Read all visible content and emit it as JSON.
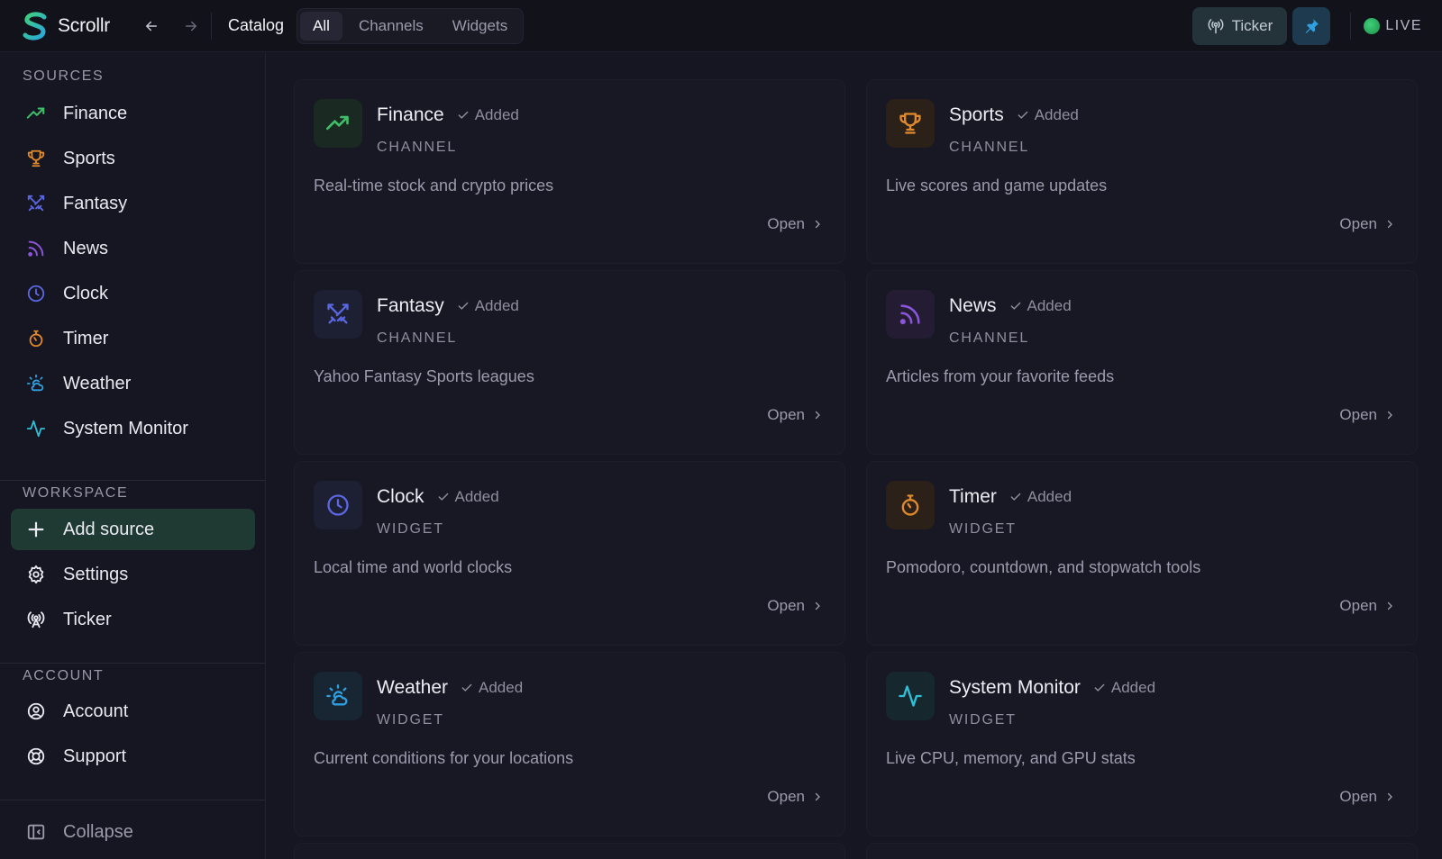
{
  "app": {
    "name": "Scrollr"
  },
  "topbar": {
    "title": "Catalog",
    "tabs": [
      {
        "label": "All",
        "active": true
      },
      {
        "label": "Channels",
        "active": false
      },
      {
        "label": "Widgets",
        "active": false
      }
    ],
    "ticker_label": "Ticker",
    "live_label": "LIVE",
    "colors": {
      "accent": "#2fa0e0",
      "live": "#2ecc71"
    }
  },
  "sidebar": {
    "sources_title": "SOURCES",
    "sources": [
      {
        "label": "Finance",
        "icon": "trending-up-icon"
      },
      {
        "label": "Sports",
        "icon": "trophy-icon"
      },
      {
        "label": "Fantasy",
        "icon": "crossed-swords-icon"
      },
      {
        "label": "News",
        "icon": "rss-icon"
      },
      {
        "label": "Clock",
        "icon": "clock-icon"
      },
      {
        "label": "Timer",
        "icon": "timer-icon"
      },
      {
        "label": "Weather",
        "icon": "weather-icon"
      },
      {
        "label": "System Monitor",
        "icon": "activity-icon"
      }
    ],
    "workspace_title": "WORKSPACE",
    "workspace": [
      {
        "label": "Add source",
        "icon": "plus-icon"
      },
      {
        "label": "Settings",
        "icon": "gear-icon"
      },
      {
        "label": "Ticker",
        "icon": "broadcast-icon"
      }
    ],
    "account_title": "ACCOUNT",
    "account": [
      {
        "label": "Account",
        "icon": "user-circle-icon"
      },
      {
        "label": "Support",
        "icon": "lifebuoy-icon"
      }
    ],
    "collapse_label": "Collapse"
  },
  "cards": [
    {
      "title": "Finance",
      "status": "Added",
      "type": "CHANNEL",
      "desc": "Real-time stock and crypto prices",
      "action": "Open",
      "color": "#3fbf6a"
    },
    {
      "title": "Sports",
      "status": "Added",
      "type": "CHANNEL",
      "desc": "Live scores and game updates",
      "action": "Open",
      "color": "#e08a2c"
    },
    {
      "title": "Fantasy",
      "status": "Added",
      "type": "CHANNEL",
      "desc": "Yahoo Fantasy Sports leagues",
      "action": "Open",
      "color": "#5a67e0"
    },
    {
      "title": "News",
      "status": "Added",
      "type": "CHANNEL",
      "desc": "Articles from your favorite feeds",
      "action": "Open",
      "color": "#8a55d8"
    },
    {
      "title": "Clock",
      "status": "Added",
      "type": "WIDGET",
      "desc": "Local time and world clocks",
      "action": "Open",
      "color": "#5a67e0"
    },
    {
      "title": "Timer",
      "status": "Added",
      "type": "WIDGET",
      "desc": "Pomodoro, countdown, and stopwatch tools",
      "action": "Open",
      "color": "#e08a2c"
    },
    {
      "title": "Weather",
      "status": "Added",
      "type": "WIDGET",
      "desc": "Current conditions for your locations",
      "action": "Open",
      "color": "#2f9fe0"
    },
    {
      "title": "System Monitor",
      "status": "Added",
      "type": "WIDGET",
      "desc": "Live CPU, memory, and GPU stats",
      "action": "Open",
      "color": "#2fc0d8"
    }
  ]
}
